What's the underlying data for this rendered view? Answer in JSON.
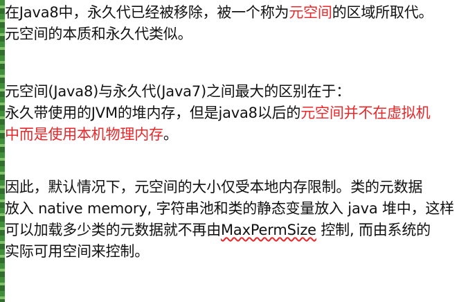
{
  "colors": {
    "text": "#111111",
    "highlight": "#e8272a",
    "stripe": "#3f8f3a"
  },
  "p1": {
    "l1_a": "在Java8中，永久代已经被移除，被一个称为",
    "l1_hl": "元空间",
    "l1_b": "的区域所取代。",
    "l2": "元空间的本质和永久代类似。"
  },
  "p2": {
    "l1": "元空间(Java8)与永久代(Java7)之间最大的区别在于：",
    "l2_a": "永久带使用的JVM的堆内存，但是java8以后的",
    "l2_hl": "元空间并不在虚拟机",
    "l3_hl": "中而是使用本机物理内存",
    "l3_b": "。"
  },
  "p3": {
    "l1": "因此，默认情况下，元空间的大小仅受本地内存限制。类的元数据",
    "l2": "放入 native memory, 字符串池和类的静态变量放入 java 堆中，这样",
    "l3_a": "可以加载多少类的元数据就不再由",
    "l3_term": "MaxPermSize",
    "l3_b": " 控制, 而由系统的",
    "l4": "实际可用空间来控制。"
  }
}
